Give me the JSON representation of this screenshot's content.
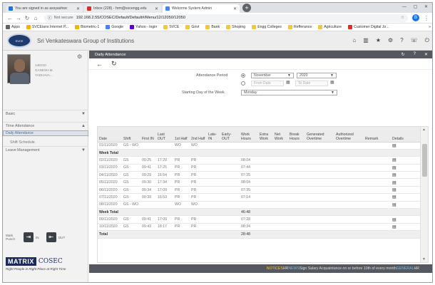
{
  "browser": {
    "tabs": [
      {
        "title": "You are signed in as assyashwc",
        "color": "#1a73e8"
      },
      {
        "title": "Inbox (228) - hrm@svcengg.edu",
        "color": "#d93025"
      },
      {
        "title": "Welcome System Admin",
        "color": "#4285f4"
      }
    ],
    "new_tab": "+",
    "window_controls": "—  ▢  ✕",
    "not_secure": "Not secure",
    "url": "192.168.2.55/COSEC/Default/Default#/Menu/12/12050/12050",
    "profile_initial": "B",
    "bookmarks": [
      {
        "label": "Apps",
        "color": "#5f6368"
      },
      {
        "label": "SVCEians Internet P...",
        "color": "#f4b400"
      },
      {
        "label": "Biometric-1",
        "color": "#f4b400"
      },
      {
        "label": "Google",
        "color": "#4285f4"
      },
      {
        "label": "Yahoo - login",
        "color": "#6001d2"
      },
      {
        "label": "SVCE",
        "color": "#f4c542"
      },
      {
        "label": "Govt",
        "color": "#f4c542"
      },
      {
        "label": "Bank",
        "color": "#f4c542"
      },
      {
        "label": "Shoping",
        "color": "#f4c542"
      },
      {
        "label": "Engg Colleges",
        "color": "#f4c542"
      },
      {
        "label": "Refferance",
        "color": "#f4c542"
      },
      {
        "label": "Agriculture",
        "color": "#f4c542"
      },
      {
        "label": "Customer Digital Jo...",
        "color": "#d93025"
      }
    ],
    "bookmarks_more": "»"
  },
  "app": {
    "org_name": "Sri Venkateswara Group of Institutions",
    "logo_text": "SVCE"
  },
  "user": {
    "id": "14E010",
    "name": "GANESH.M.",
    "dept": "YADHAVA..."
  },
  "sidebar": {
    "sections": [
      {
        "label": "Basic",
        "caret": "▼"
      },
      {
        "label": "Time Attendance",
        "caret": "▲"
      },
      {
        "label": "Leave Management",
        "caret": "▼"
      }
    ],
    "items": [
      {
        "label": "Daily Attendance"
      },
      {
        "label": "Shift Schedule"
      }
    ],
    "mark_punch": "Mark Punch",
    "in_label": "IN",
    "out_label": "OUT",
    "brand": "MATRIX",
    "brand_suffix": "COSEC",
    "tagline": "Right People in Right Place at Right Time"
  },
  "page": {
    "title": "Daily Attendance",
    "attendance_period_label": "Attendance Period",
    "month_value": "November",
    "year_value": "2020",
    "from_date_placeholder": "From Date",
    "to_date_placeholder": "To Date",
    "start_day_label": "Starting Day of the Week",
    "start_day_value": "Monday"
  },
  "table": {
    "headers": [
      "Date",
      "Shift",
      "First IN",
      "Last OUT",
      "1st Half",
      "2nd Half",
      "Late-IN",
      "Early-OUT",
      "Work Hours",
      "Extra Work",
      "Net Work",
      "Break Hours",
      "Generated Overtime",
      "Authorized Overtime",
      "Remark",
      "Details"
    ],
    "rows": [
      {
        "type": "day",
        "cells": [
          "01/11/2020",
          "GS - WO",
          "",
          "",
          "WO",
          "WO",
          "",
          "",
          "",
          "",
          "",
          "",
          "",
          "",
          "",
          "▤"
        ]
      },
      {
        "type": "week",
        "label": "Week Total",
        "hours": ""
      },
      {
        "type": "day",
        "cells": [
          "02/11/2020",
          "GS",
          "09:25",
          "17:29",
          "PR",
          "PR",
          "",
          "",
          "08:04",
          "",
          "",
          "",
          "",
          "",
          "",
          "▤"
        ]
      },
      {
        "type": "day",
        "cells": [
          "03/11/2020",
          "GS",
          "09:41",
          "17:25",
          "PR",
          "PR",
          "",
          "",
          "07:44",
          "",
          "",
          "",
          "",
          "",
          "",
          "▤"
        ]
      },
      {
        "type": "day",
        "cells": [
          "04/11/2020",
          "GS",
          "09:29",
          "16:54",
          "PR",
          "PR",
          "",
          "",
          "07:25",
          "",
          "",
          "",
          "",
          "",
          "",
          "▤"
        ]
      },
      {
        "type": "day",
        "cells": [
          "05/11/2020",
          "GS",
          "09:30",
          "17:34",
          "PR",
          "PR",
          "",
          "",
          "08:04",
          "",
          "",
          "",
          "",
          "",
          "",
          "▤"
        ]
      },
      {
        "type": "day",
        "cells": [
          "06/11/2020",
          "GS",
          "09:34",
          "17:09",
          "PR",
          "PR",
          "",
          "",
          "07:35",
          "",
          "",
          "",
          "",
          "",
          "",
          "▤"
        ]
      },
      {
        "type": "day",
        "cells": [
          "07/11/2020",
          "GS",
          "09:39",
          "16:53",
          "PR",
          "PR",
          "",
          "",
          "07:14",
          "",
          "",
          "",
          "",
          "",
          "",
          "▤"
        ]
      },
      {
        "type": "day",
        "cells": [
          "08/11/2020",
          "GS - WO",
          "",
          "",
          "WO",
          "WO",
          "",
          "",
          "",
          "",
          "",
          "",
          "",
          "",
          "",
          "▤"
        ]
      },
      {
        "type": "week",
        "label": "Week Total",
        "hours": "46:48"
      },
      {
        "type": "day",
        "cells": [
          "09/11/2020",
          "GS",
          "09:41",
          "17:09",
          "PR",
          "PR",
          "",
          "",
          "07:28",
          "",
          "",
          "",
          "",
          "",
          "",
          "▤"
        ]
      },
      {
        "type": "day",
        "cells": [
          "10/11/2020",
          "GS",
          "09:43",
          "18:17",
          "PR",
          "PR",
          "",
          "",
          "08:34",
          "",
          "",
          "",
          "",
          "",
          "",
          "▤"
        ]
      },
      {
        "type": "total",
        "label": "Total",
        "hours": "28:48"
      }
    ]
  },
  "notice": {
    "tag": "NOTICES",
    "prefix": "HR ",
    "news": "NEWS",
    "text": " Sign Salary Acquaintance on or before 10th of every month ",
    "general": "GENERAL",
    "suffix": " HR"
  }
}
